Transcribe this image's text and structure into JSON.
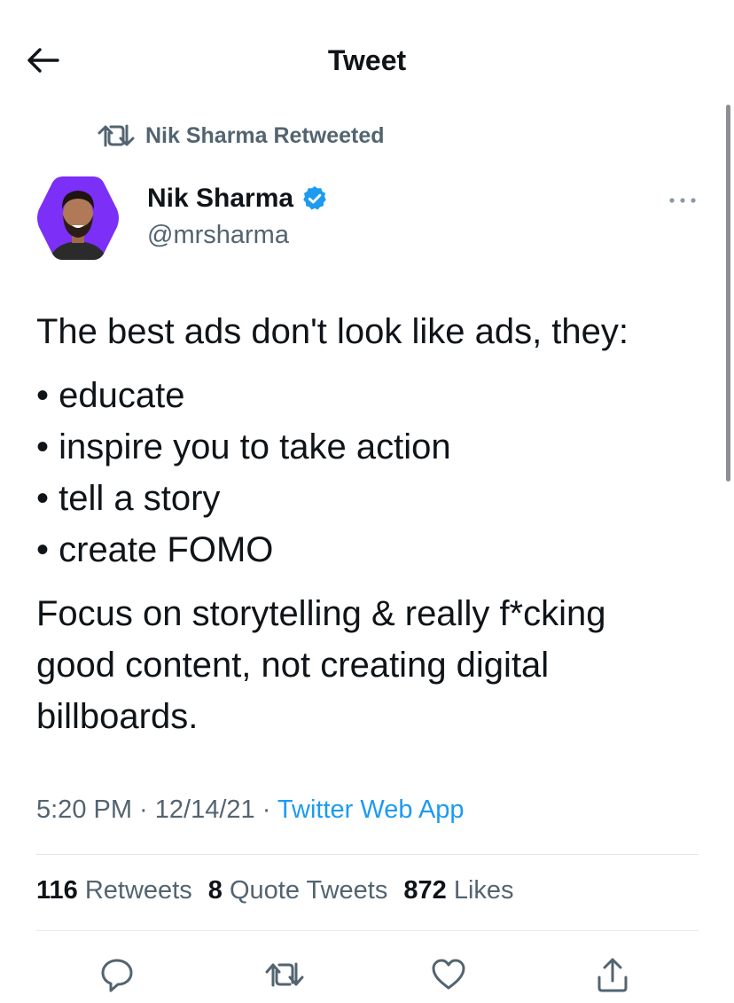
{
  "header": {
    "title": "Tweet",
    "back_icon": "arrow-left-icon"
  },
  "retweet_context": {
    "label": "Nik Sharma Retweeted",
    "icon": "retweet-icon"
  },
  "author": {
    "name": "Nik Sharma",
    "handle": "@mrsharma",
    "verified": true,
    "avatar_color": "#7b2ff7"
  },
  "tweet": {
    "intro": "The best ads don't look like ads, they:",
    "bullets": [
      "• educate",
      "• inspire you to take action",
      "• tell a story",
      "• create FOMO"
    ],
    "closing_line1": "Focus on storytelling & really f*cking",
    "closing_line2": "good content, not creating digital",
    "closing_line3": "billboards."
  },
  "meta": {
    "time": "5:20 PM",
    "sep1": " · ",
    "date": "12/14/21",
    "sep2": " · ",
    "source": "Twitter Web App"
  },
  "stats": {
    "retweets_count": "116",
    "retweets_label": "Retweets",
    "quotes_count": "8",
    "quotes_label": "Quote Tweets",
    "likes_count": "872",
    "likes_label": "Likes"
  },
  "actions": [
    "reply-icon",
    "retweet-icon",
    "like-icon",
    "share-icon"
  ],
  "colors": {
    "accent": "#1d9bf0",
    "secondary_text": "#536471",
    "primary_text": "#0f1419",
    "divider": "#e1e8ed"
  }
}
